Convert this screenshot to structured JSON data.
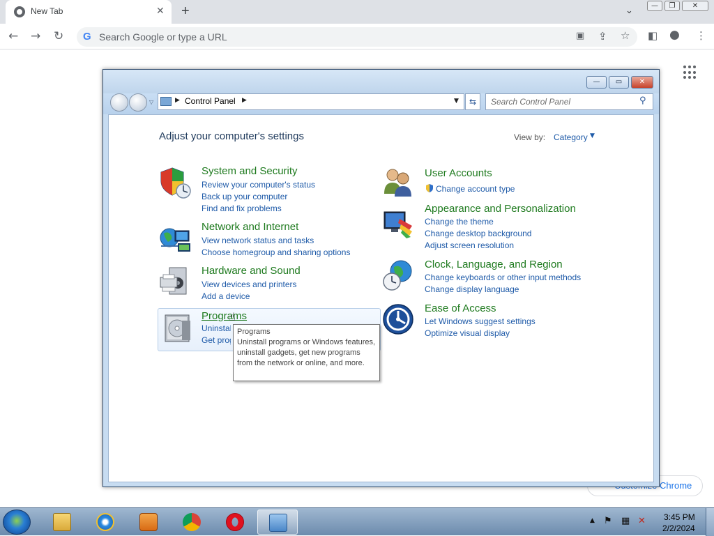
{
  "browser": {
    "tab_title": "New Tab",
    "tab_close": "✕",
    "new_tab": "+",
    "tab_dropdown": "⌄",
    "omnibox_placeholder": "Search Google or type a URL",
    "google_g": "G",
    "customize_label": "Customize Chrome",
    "window_controls": {
      "minimize": "—",
      "restore": "❐",
      "close": "✕"
    }
  },
  "control_panel": {
    "window_controls": {
      "minimize": "—",
      "maximize": "▭",
      "close": "✕"
    },
    "breadcrumb": "Control Panel",
    "search_placeholder": "Search Control Panel",
    "heading": "Adjust your computer's settings",
    "view_by_label": "View by:",
    "view_by_value": "Category",
    "categories": [
      {
        "title": "System and Security",
        "links": [
          "Review your computer's status",
          "Back up your computer",
          "Find and fix problems"
        ]
      },
      {
        "title": "Network and Internet",
        "links": [
          "View network status and tasks",
          "Choose homegroup and sharing options"
        ]
      },
      {
        "title": "Hardware and Sound",
        "links": [
          "View devices and printers",
          "Add a device"
        ]
      },
      {
        "title": "Programs",
        "links": [
          "Uninstall a program",
          "Get programs"
        ]
      },
      {
        "title": "User Accounts",
        "links": [
          "Change account type"
        ]
      },
      {
        "title": "Appearance and Personalization",
        "links": [
          "Change the theme",
          "Change desktop background",
          "Adjust screen resolution"
        ]
      },
      {
        "title": "Clock, Language, and Region",
        "links": [
          "Change keyboards or other input methods",
          "Change display language"
        ]
      },
      {
        "title": "Ease of Access",
        "links": [
          "Let Windows suggest settings",
          "Optimize visual display"
        ]
      }
    ],
    "tooltip": {
      "title": "Programs",
      "body": "Uninstall programs or Windows features, uninstall gadgets, get new programs from the network or online, and more."
    }
  },
  "taskbar": {
    "pinned": [
      "windows-explorer",
      "internet-explorer",
      "media-player",
      "chrome",
      "opera",
      "control-panel"
    ],
    "active": "control-panel",
    "clock_time": "3:45 PM",
    "clock_date": "2/2/2024"
  }
}
